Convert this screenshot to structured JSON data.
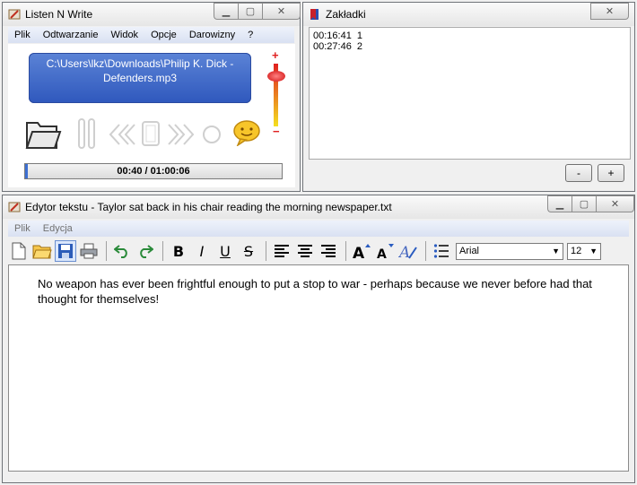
{
  "lnw": {
    "title": "Listen N Write",
    "menu": [
      "Plik",
      "Odtwarzanie",
      "Widok",
      "Opcje",
      "Darowizny",
      "?"
    ],
    "file_line1": "C:\\Users\\lkz\\Downloads\\Philip K. Dick -",
    "file_line2": "Defenders.mp3",
    "time": "00:40 / 01:00:06",
    "progress_fraction": 0.011,
    "volume_fraction": 0.8,
    "volume_plus": "+",
    "volume_minus": "−",
    "icons": [
      "folder-open-icon",
      "pause-icon",
      "rewind-icon",
      "stop-icon",
      "fast-forward-icon",
      "record-icon",
      "chat-bubble-icon"
    ]
  },
  "zak": {
    "title": "Zakładki",
    "bookmarks": [
      "00:16:41  1",
      "00:27:46  2"
    ],
    "minus": "-",
    "plus": "+"
  },
  "editor": {
    "title": "Edytor tekstu - Taylor sat back in his chair reading the morning newspaper.txt",
    "menu": [
      "Plik",
      "Edycja"
    ],
    "bold": "B",
    "italic": "I",
    "underline": "U",
    "strike": "S",
    "font": "Arial",
    "size": "12",
    "text": "No weapon has ever been frightful enough to put a stop to war - perhaps because we never before had that thought for themselves!"
  },
  "colors": {
    "accent": "#3d6fd1",
    "file_panel": "#3a63c8",
    "volume_red": "#e02020",
    "volume_yellow": "#f4e020"
  }
}
